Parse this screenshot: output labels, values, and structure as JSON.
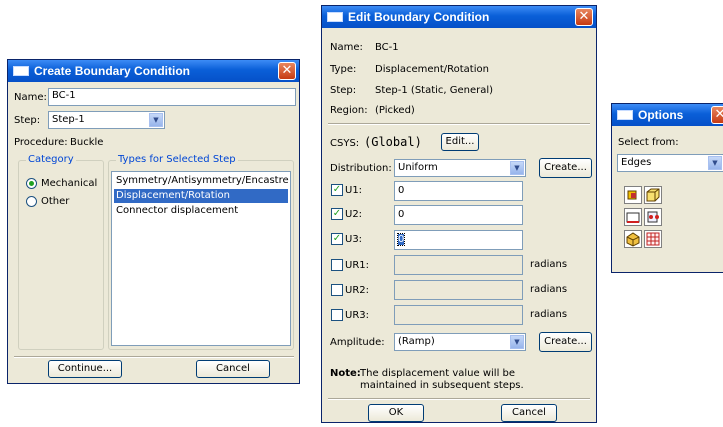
{
  "create_bc": {
    "title": "Create Boundary Condition",
    "name_label": "Name:",
    "name_value": "BC-1",
    "step_label": "Step:",
    "step_value": "Step-1",
    "procedure_label": "Procedure:",
    "procedure_value": "Buckle",
    "category_title": "Category",
    "categories": [
      "Mechanical",
      "Other"
    ],
    "selected_category": "Mechanical",
    "types_title": "Types for Selected Step",
    "types": [
      "Symmetry/Antisymmetry/Encastre",
      "Displacement/Rotation",
      "Connector displacement"
    ],
    "selected_type": "Displacement/Rotation",
    "continue_label": "Continue...",
    "cancel_label": "Cancel"
  },
  "edit_bc": {
    "title": "Edit Boundary Condition",
    "name_label": "Name:",
    "name_value": "BC-1",
    "type_label": "Type:",
    "type_value": "Displacement/Rotation",
    "step_label": "Step:",
    "step_value": "Step-1 (Static, General)",
    "region_label": "Region:",
    "region_value": "(Picked)",
    "csys_label": "CSYS:",
    "csys_value": "(Global)",
    "edit_label": "Edit...",
    "distribution_label": "Distribution:",
    "distribution_value": "Uniform",
    "create_label": "Create...",
    "dofs": [
      {
        "label": "U1:",
        "checked": true,
        "value": "0",
        "unit": ""
      },
      {
        "label": "U2:",
        "checked": true,
        "value": "0",
        "unit": ""
      },
      {
        "label": "U3:",
        "checked": true,
        "value": "0",
        "unit": ""
      },
      {
        "label": "UR1:",
        "checked": false,
        "value": "",
        "unit": "radians"
      },
      {
        "label": "UR2:",
        "checked": false,
        "value": "",
        "unit": "radians"
      },
      {
        "label": "UR3:",
        "checked": false,
        "value": "",
        "unit": "radians"
      }
    ],
    "amplitude_label": "Amplitude:",
    "amplitude_value": "(Ramp)",
    "amplitude_create_label": "Create...",
    "note_label": "Note:",
    "note_line1": "The displacement value will be",
    "note_line2": "maintained in subsequent steps.",
    "ok_label": "OK",
    "cancel_label": "Cancel"
  },
  "options": {
    "title": "Options",
    "select_from_label": "Select from:",
    "select_from_value": "Edges",
    "tool_icons": [
      "select-vertices-icon",
      "select-faces-icon",
      "select-edges-icon",
      "select-nodes-icon",
      "select-cells-icon",
      "select-mesh-icon"
    ]
  },
  "colors": {
    "titlebar": "#0a5fd8",
    "window_face": "#ece9d8",
    "selection": "#316ac5",
    "group_label": "#0046d5",
    "check": "#21a121"
  }
}
